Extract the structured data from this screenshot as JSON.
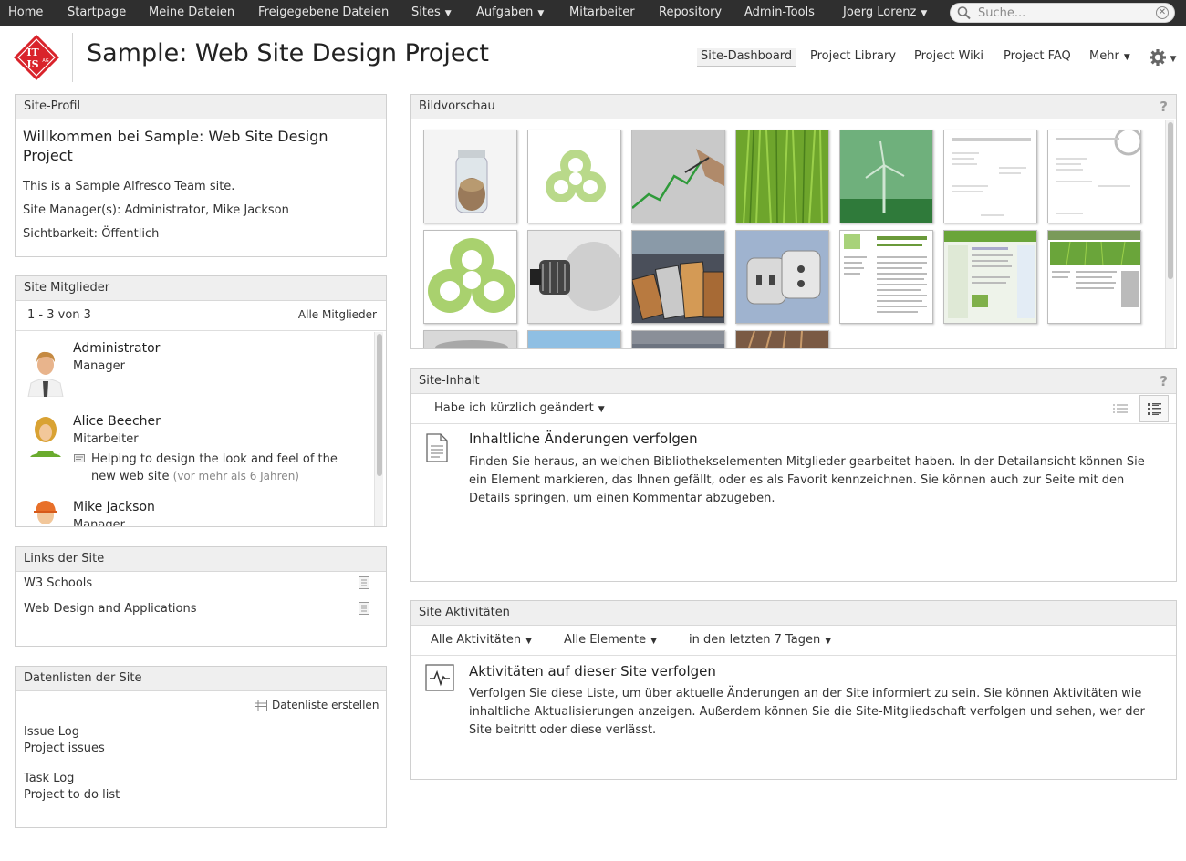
{
  "topnav": {
    "items": [
      "Home",
      "Startpage",
      "Meine Dateien",
      "Freigegebene Dateien",
      "Sites",
      "Aufgaben",
      "Mitarbeiter",
      "Repository",
      "Admin-Tools",
      "Joerg Lorenz"
    ],
    "search_placeholder": "Suche..."
  },
  "header": {
    "logo_text": "IT IS AG",
    "title": "Sample: Web Site Design Project",
    "nav": [
      "Site-Dashboard",
      "Project Library",
      "Project Wiki",
      "Project FAQ",
      "Mehr"
    ]
  },
  "site_profile": {
    "title": "Site-Profil",
    "welcome": "Willkommen bei Sample: Web Site Design Project",
    "description": "This is a Sample Alfresco Team site.",
    "managers": "Site Manager(s): Administrator, Mike Jackson",
    "visibility": "Sichtbarkeit: Öffentlich"
  },
  "members": {
    "title": "Site Mitglieder",
    "count": "1 - 3 von 3",
    "all_link": "Alle Mitglieder",
    "list": [
      {
        "name": "Administrator",
        "role": "Manager"
      },
      {
        "name": "Alice Beecher",
        "role": "Mitarbeiter",
        "status": "Helping to design the look and feel of the new web site",
        "status_time": "(vor mehr als 6 Jahren)"
      },
      {
        "name": "Mike Jackson",
        "role": "Manager"
      }
    ]
  },
  "links": {
    "title": "Links der Site",
    "items": [
      "W3 Schools",
      "Web Design and Applications"
    ]
  },
  "datalists": {
    "title": "Datenlisten der Site",
    "create": "Datenliste erstellen",
    "items": [
      {
        "name": "Issue Log",
        "desc": "Project issues"
      },
      {
        "name": "Task Log",
        "desc": "Project to do list"
      }
    ]
  },
  "image_preview": {
    "title": "Bildvorschau",
    "help": "?",
    "thumbnails": [
      "coin-jar",
      "green-logo",
      "chart-hand",
      "grass",
      "wind-turbine",
      "document-page",
      "document-page-2",
      "green-logo-large",
      "light-bulb",
      "coins",
      "power-plug",
      "website-page",
      "website-page-2",
      "website-page-3",
      "stone-stack",
      "sky",
      "landscape",
      "cables"
    ]
  },
  "site_content": {
    "title": "Site-Inhalt",
    "help": "?",
    "filter": "Habe ich kürzlich geändert",
    "heading": "Inhaltliche Änderungen verfolgen",
    "text": "Finden Sie heraus, an welchen Bibliothekselementen Mitglieder gearbeitet haben. In der Detailansicht können Sie ein Element markieren, das Ihnen gefällt, oder es als Favorit kennzeichnen. Sie können auch zur Seite mit den Details springen, um einen Kommentar abzugeben."
  },
  "site_activities": {
    "title": "Site Aktivitäten",
    "filters": [
      "Alle Aktivitäten",
      "Alle Elemente",
      "in den letzten 7 Tagen"
    ],
    "heading": "Aktivitäten auf dieser Site verfolgen",
    "text": "Verfolgen Sie diese Liste, um über aktuelle Änderungen an der Site informiert zu sein. Sie können Aktivitäten wie inhaltliche Aktualisierungen anzeigen. Außerdem können Sie die Site-Mitgliedschaft verfolgen und sehen, wer der Site beitritt oder diese verlässt."
  },
  "colors": {
    "topbar": "#2f2f2f",
    "logo_red": "#d9232b",
    "panel_header": "#efefef",
    "accent_green": "#8cc63e"
  }
}
